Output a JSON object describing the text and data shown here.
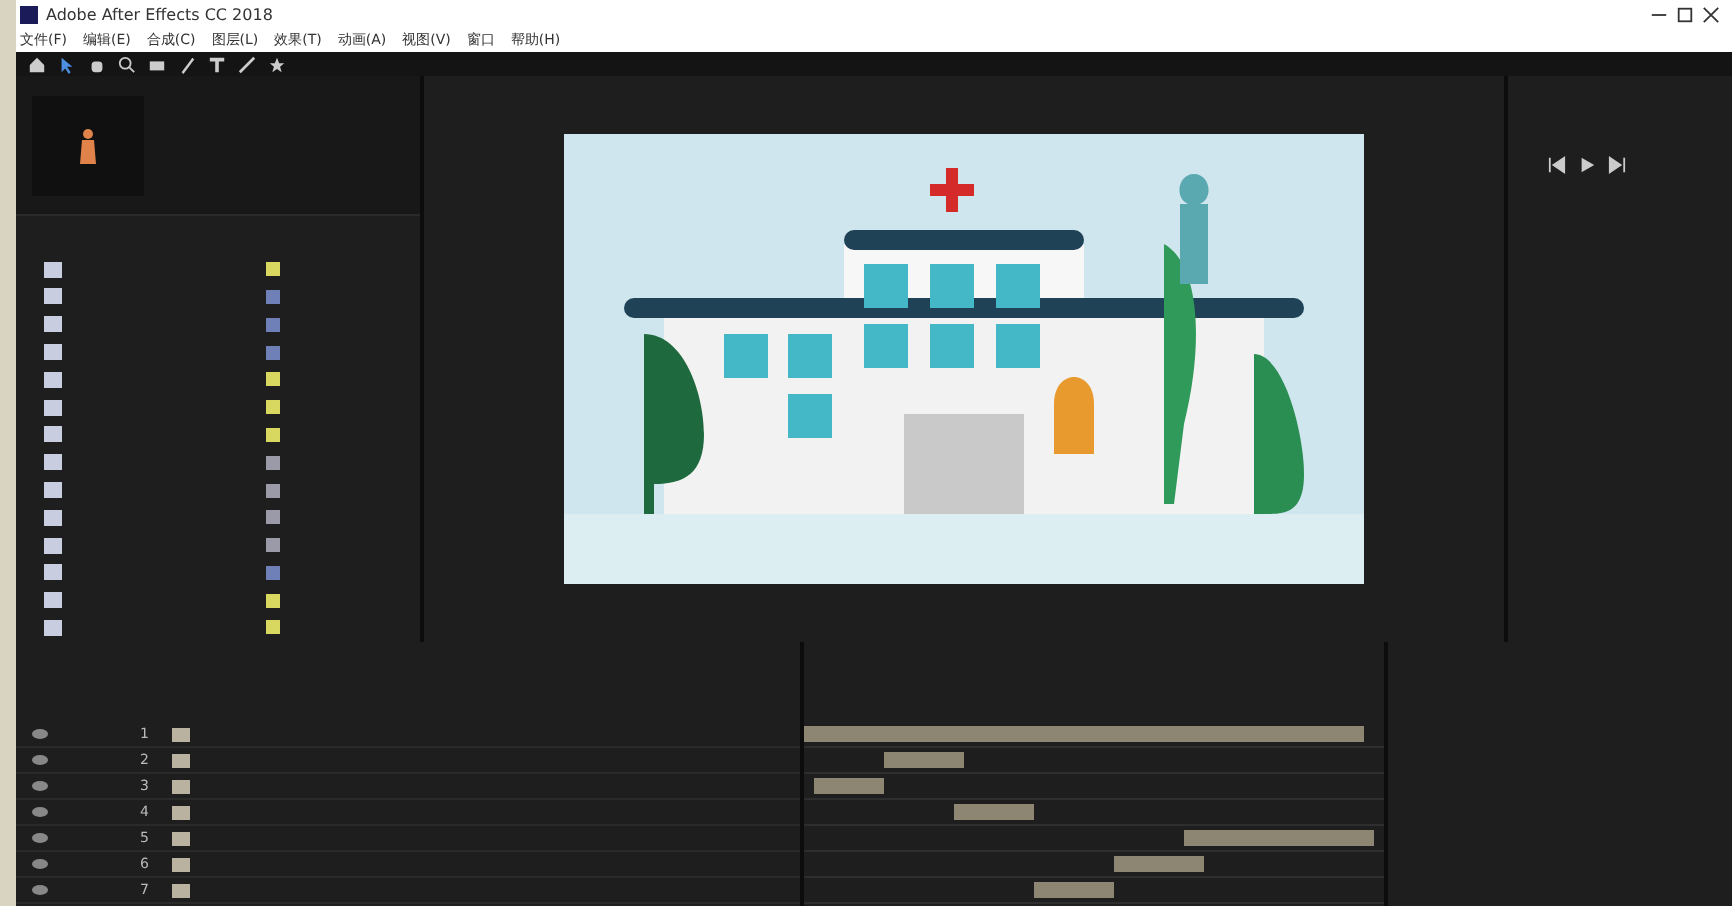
{
  "window": {
    "title": "Adobe After Effects CC 2018"
  },
  "menu": [
    "文件(F)",
    "编辑(E)",
    "合成(C)",
    "图层(L)",
    "效果(T)",
    "动画(A)",
    "视图(V)",
    "窗口",
    "帮助(H)"
  ],
  "project": {
    "items": [
      {
        "color": "#d8d860"
      },
      {
        "color": "#6f7fb8"
      },
      {
        "color": "#6f7fb8"
      },
      {
        "color": "#6f7fb8"
      },
      {
        "color": "#d8d860"
      },
      {
        "color": "#d8d860"
      },
      {
        "color": "#d8d860"
      },
      {
        "color": "#9a9aa8"
      },
      {
        "color": "#9a9aa8"
      },
      {
        "color": "#9a9aa8"
      },
      {
        "color": "#9a9aa8"
      },
      {
        "color": "#6f7fb8"
      },
      {
        "color": "#d8d860"
      },
      {
        "color": "#d8d860"
      }
    ]
  },
  "timeline": {
    "layers": [
      {
        "number": "1"
      },
      {
        "number": "2"
      },
      {
        "number": "3"
      },
      {
        "number": "4"
      },
      {
        "number": "5"
      },
      {
        "number": "6"
      },
      {
        "number": "7"
      }
    ]
  }
}
